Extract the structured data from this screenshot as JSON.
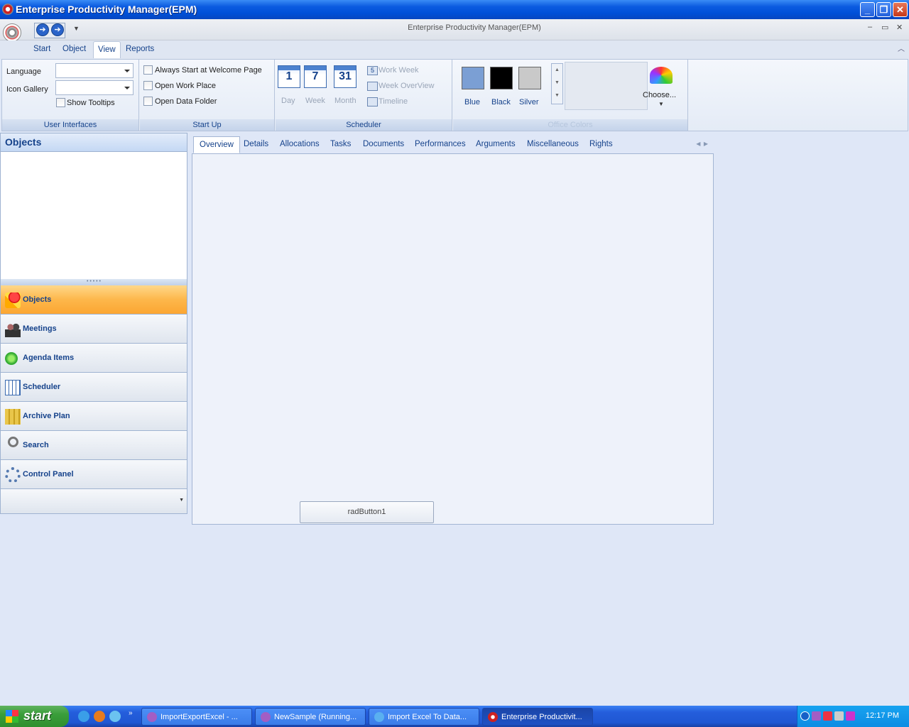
{
  "window": {
    "title": "Enterprise Productivity Manager(EPM)",
    "inner_title": "Enterprise Productivity Manager(EPM)"
  },
  "ribbon": {
    "tabs": [
      "Start",
      "Object",
      "View",
      "Reports"
    ],
    "active_tab": "View",
    "groups": {
      "ui": {
        "label": "User Interfaces",
        "language": "Language",
        "icon_gallery": "Icon Gallery",
        "show_tooltips": "Show Tooltips"
      },
      "startup": {
        "label": "Start Up",
        "always_start": "Always Start at Welcome Page",
        "open_work_place": "Open Work Place",
        "open_data_folder": "Open Data Folder"
      },
      "scheduler": {
        "label": "Scheduler",
        "day": "Day",
        "day_icon": "1",
        "week": "Week",
        "week_icon": "7",
        "month": "Month",
        "month_icon": "31",
        "work_week": "Work Week",
        "work_week_icon": "5",
        "week_overview": "Week OverView",
        "timeline": "Timeline"
      },
      "colors": {
        "label": "Office Colors",
        "blue": "Blue",
        "black": "Black",
        "silver": "Silver",
        "choose": "Choose...",
        "blue_hex": "#7b9fd4",
        "black_hex": "#000000",
        "silver_hex": "#c9c9c9"
      }
    }
  },
  "nav": {
    "header": "Objects",
    "items": [
      "Objects",
      "Meetings",
      "Agenda Items",
      "Scheduler",
      "Archive Plan",
      "Search",
      "Control Panel"
    ],
    "active": "Objects"
  },
  "content": {
    "tabs": [
      "Overview",
      "Details",
      "Allocations",
      "Tasks",
      "Documents",
      "Performances",
      "Arguments",
      "Miscellaneous",
      "Rights"
    ],
    "active_tab": "Overview",
    "button": "radButton1"
  },
  "taskbar": {
    "start": "start",
    "items": [
      "ImportExportExcel - ...",
      "NewSample (Running...",
      "Import Excel To Data...",
      "Enterprise Productivit..."
    ],
    "active_item": "Enterprise Productivit...",
    "clock": "12:17 PM"
  }
}
